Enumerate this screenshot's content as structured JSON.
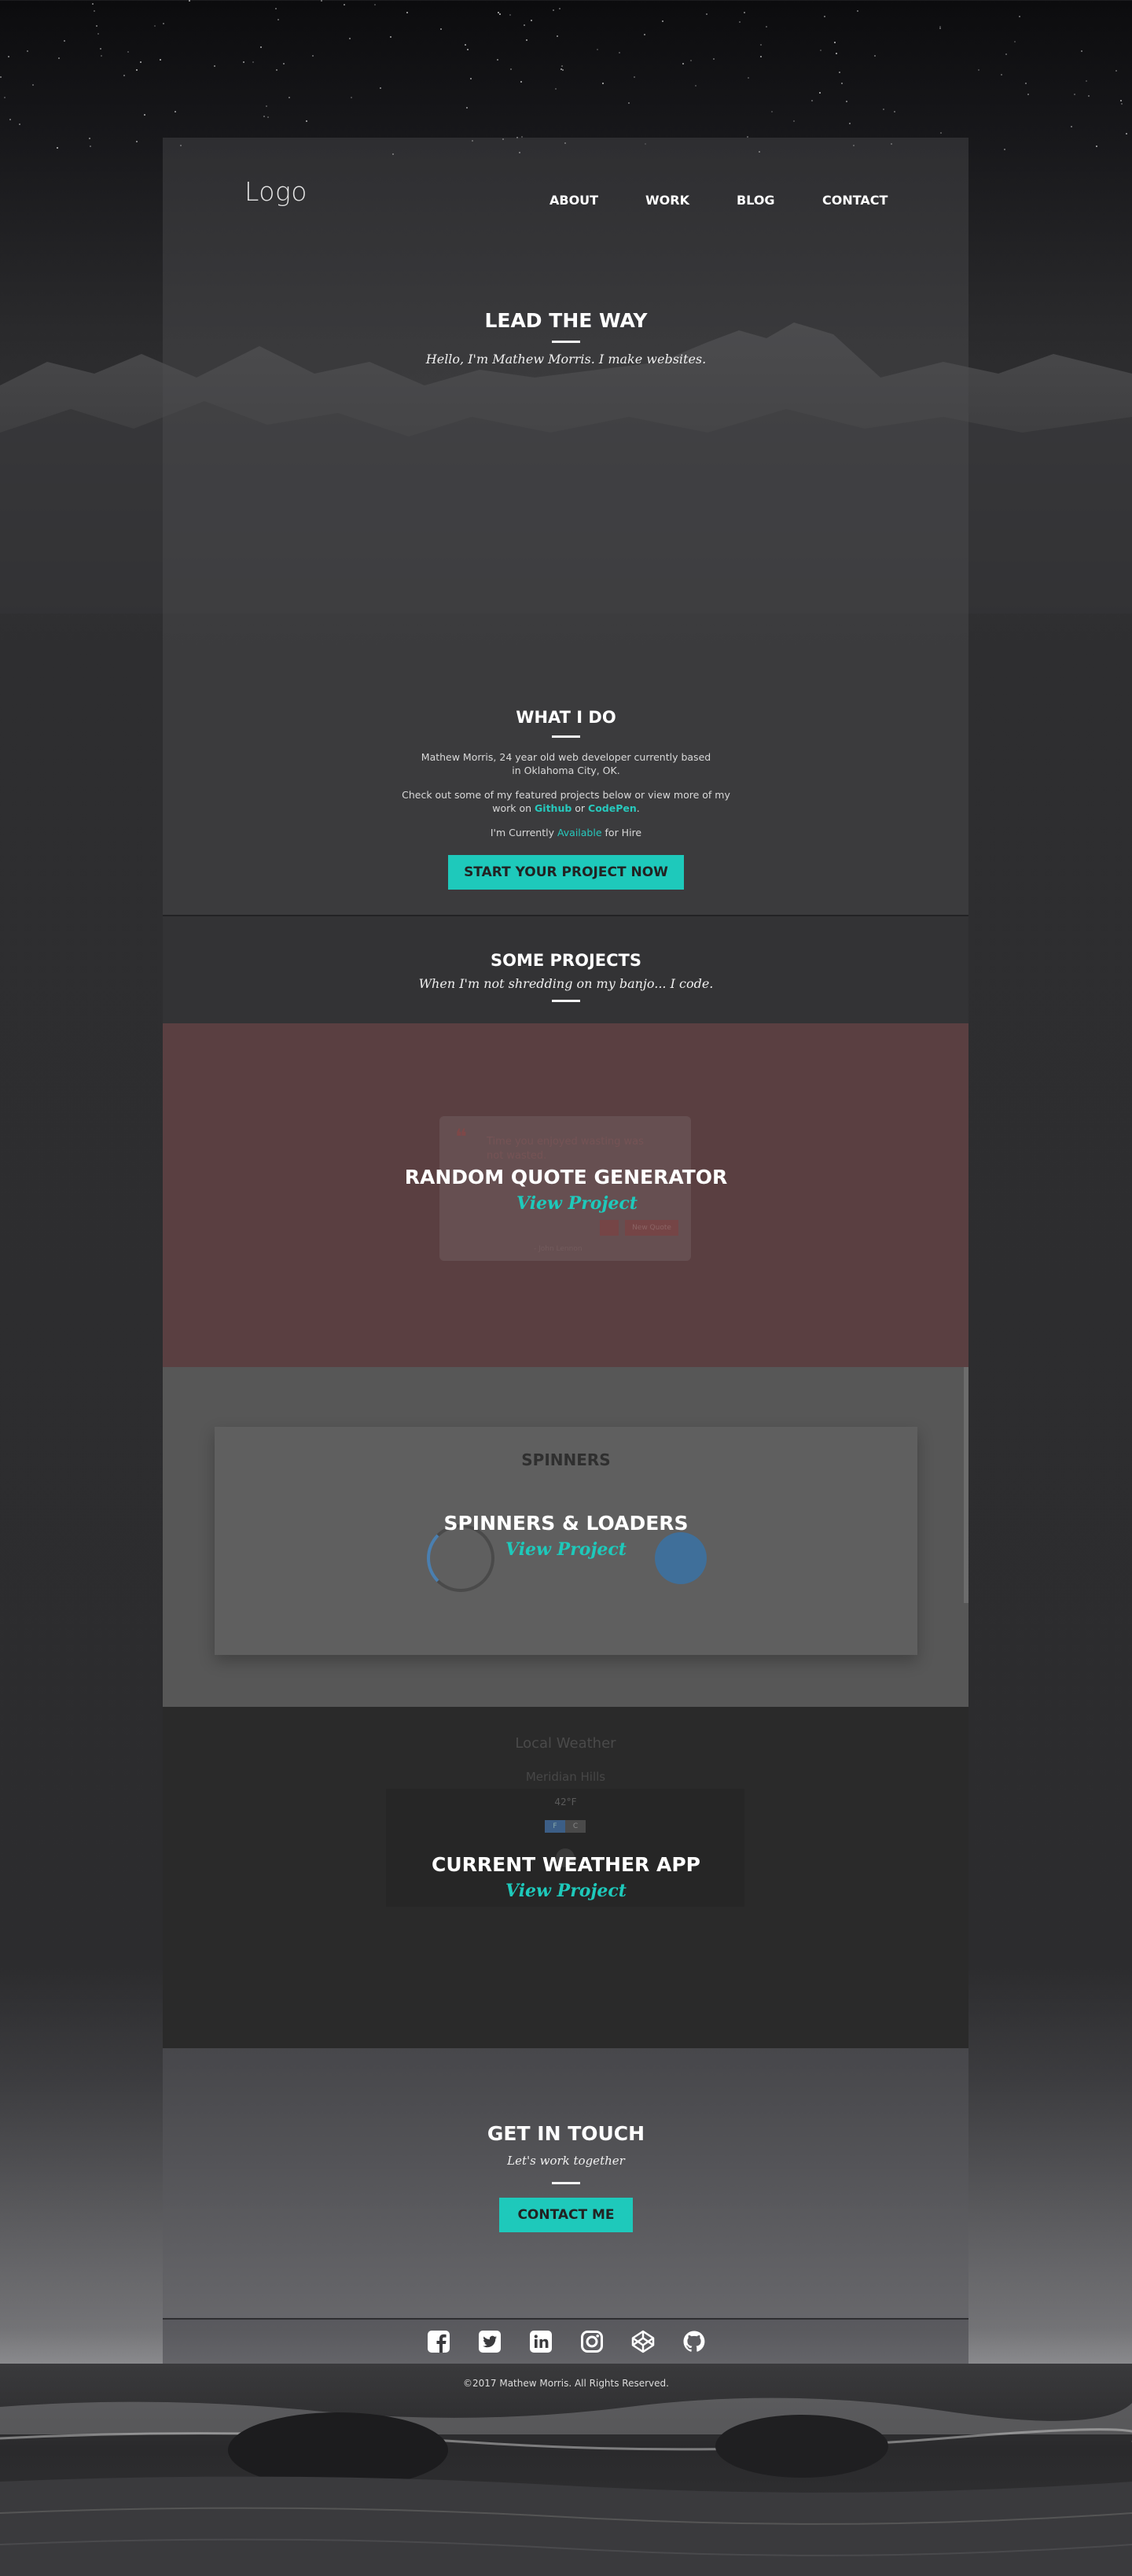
{
  "header": {
    "logo": "Logo",
    "nav": [
      "ABOUT",
      "WORK",
      "BLOG",
      "CONTACT"
    ]
  },
  "hero": {
    "title": "LEAD THE WAY",
    "subtitle": "Hello, I'm Mathew Morris. I make websites."
  },
  "about": {
    "title": "WHAT I DO",
    "para1": "Mathew Morris, 24 year old web developer currently based in Oklahoma City, OK.",
    "para2_before": "Check out some of my featured projects below or view more of my work on ",
    "link_github": "Github",
    "para2_or": " or ",
    "link_codepen": "CodePen",
    "para2_end": ".",
    "status_before": "I'm Currently ",
    "status_word": "Available",
    "status_after": " for Hire",
    "cta": "START YOUR PROJECT NOW"
  },
  "projects": {
    "title": "SOME PROJECTS",
    "subtitle": "When I'm not shredding on my banjo... I code.",
    "items": [
      {
        "title": "RANDOM QUOTE GENERATOR",
        "link": "View Project",
        "preview": {
          "quote": "Time you enjoyed wasting was not wasted.",
          "button": "New Quote",
          "author": "- John Lennon"
        }
      },
      {
        "title": "SPINNERS & LOADERS",
        "link": "View Project",
        "preview": {
          "heading": "SPINNERS"
        }
      },
      {
        "title": "CURRENT WEATHER APP",
        "link": "View Project",
        "preview": {
          "heading": "Local Weather",
          "location": "Meridian Hills",
          "temp": "42°F",
          "unit_f": "F",
          "unit_c": "C"
        }
      }
    ]
  },
  "contact": {
    "title": "GET IN TOUCH",
    "subtitle": "Let's work together",
    "button": "CONTACT ME"
  },
  "footer": {
    "icons": [
      "facebook-icon",
      "twitter-icon",
      "linkedin-icon",
      "instagram-icon",
      "codepen-icon",
      "github-icon"
    ],
    "copyright": "©2017 Mathew Morris. All Rights Reserved."
  },
  "colors": {
    "accent": "#1ec9bb",
    "quote_bg": "#5a3f41",
    "spinner_bg": "#575757",
    "weather_bg": "#2a2a2a"
  }
}
